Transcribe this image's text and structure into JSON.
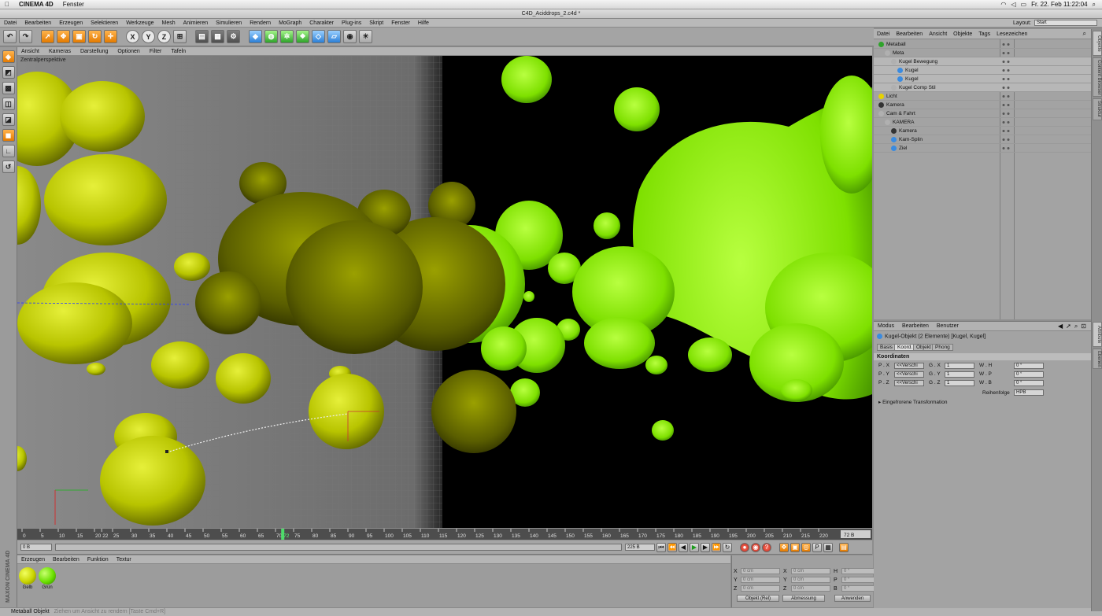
{
  "mac_menu": {
    "app": "CINEMA 4D",
    "items": [
      "Fenster"
    ],
    "datetime": "Fr. 22. Feb  11:22:04"
  },
  "window_title": "C4D_Aciddrops_2.c4d *",
  "app_menu": [
    "Datei",
    "Bearbeiten",
    "Erzeugen",
    "Selektieren",
    "Werkzeuge",
    "Mesh",
    "Animieren",
    "Simulieren",
    "Rendern",
    "MoGraph",
    "Charakter",
    "Plug-ins",
    "Skript",
    "Fenster",
    "Hilfe"
  ],
  "layout": {
    "label": "Layout:",
    "value": "Start"
  },
  "toolbar": {
    "x_label": "X",
    "y_label": "Y",
    "z_label": "Z"
  },
  "viewport": {
    "menu": [
      "Ansicht",
      "Kameras",
      "Darstellung",
      "Optionen",
      "Filter",
      "Tafeln"
    ],
    "label": "Zentralperspektive"
  },
  "timeline": {
    "ticks": [
      "0",
      "5",
      "10",
      "15",
      "20",
      "25",
      "30",
      "35",
      "40",
      "45",
      "50",
      "55",
      "60",
      "65",
      "70",
      "72",
      "75",
      "80",
      "85",
      "90",
      "95",
      "100",
      "105",
      "110",
      "115",
      "120",
      "125",
      "130",
      "135",
      "140",
      "145",
      "150",
      "155",
      "160",
      "165",
      "170",
      "175",
      "180",
      "185",
      "190",
      "195",
      "200",
      "205",
      "210",
      "215",
      "220",
      "22"
    ],
    "current_frame": "72",
    "right_field": "72 B",
    "start_field": "0 B",
    "end_field": "225 B"
  },
  "material_manager": {
    "menu": [
      "Erzeugen",
      "Bearbeiten",
      "Funktion",
      "Textur"
    ],
    "materials": [
      {
        "name": "Gelb",
        "color": "#c8d400"
      },
      {
        "name": "Grün",
        "color": "#6ae000"
      }
    ]
  },
  "coordinates": {
    "rows": [
      {
        "axis": "X",
        "pos": "0 cm",
        "size_axis": "X",
        "size": "0 cm",
        "rot_axis": "H",
        "rot": "0 °"
      },
      {
        "axis": "Y",
        "pos": "0 cm",
        "size_axis": "Y",
        "size": "0 cm",
        "rot_axis": "P",
        "rot": "0 °"
      },
      {
        "axis": "Z",
        "pos": "0 cm",
        "size_axis": "Z",
        "size": "0 cm",
        "rot_axis": "B",
        "rot": "0 °"
      }
    ],
    "mode": "Objekt (Rel)",
    "measure": "Abmessung",
    "apply": "Anwenden"
  },
  "object_manager": {
    "menu": [
      "Datei",
      "Bearbeiten",
      "Ansicht",
      "Objekte",
      "Tags",
      "Lesezeichen"
    ],
    "objects": [
      {
        "name": "Metaball",
        "indent": 0,
        "color": "#2fa32b"
      },
      {
        "name": "Meta",
        "indent": 1,
        "color": "#b0b0b0"
      },
      {
        "name": "Kugel Bewegung",
        "indent": 2,
        "color": "#b0b0b0"
      },
      {
        "name": "Kugel",
        "indent": 3,
        "color": "#3a8be0"
      },
      {
        "name": "Kugel",
        "indent": 3,
        "color": "#3a8be0"
      },
      {
        "name": "Kugel Comp Stil",
        "indent": 2,
        "color": "#b0b0b0"
      },
      {
        "name": "Licht",
        "indent": 0,
        "color": "#e6d200"
      },
      {
        "name": "Kamera",
        "indent": 0,
        "color": "#333333"
      },
      {
        "name": "Cam & Fahrt",
        "indent": 0,
        "color": "#b0b0b0"
      },
      {
        "name": "KAMERA",
        "indent": 1,
        "color": "#b0b0b0"
      },
      {
        "name": "Kamera",
        "indent": 2,
        "color": "#333333"
      },
      {
        "name": "Kam-Splin",
        "indent": 2,
        "color": "#3a8be0"
      },
      {
        "name": "Ziel",
        "indent": 2,
        "color": "#3a8be0"
      }
    ]
  },
  "attribute_manager": {
    "menu": [
      "Modus",
      "Bearbeiten",
      "Benutzer"
    ],
    "title": "Kugel-Objekt (2 Elemente) [Kugel, Kugel]",
    "tabs": [
      "Basis",
      "Koord.",
      "Objekt",
      "Phong"
    ],
    "active_tab": "Koord.",
    "section": "Koordinaten",
    "rows": [
      {
        "p": "P . X",
        "pv": "<<Verschi",
        "g": "G . X",
        "gv": "1",
        "w": "W . H",
        "wv": "0 °"
      },
      {
        "p": "P . Y",
        "pv": "<<Verschi",
        "g": "G . Y",
        "gv": "1",
        "w": "W . P",
        "wv": "0 °"
      },
      {
        "p": "P . Z",
        "pv": "<<Verschi",
        "g": "G . Z",
        "gv": "1",
        "w": "W . B",
        "wv": "0 °"
      }
    ],
    "order_label": "Reihenfolge",
    "order_value": "HPB",
    "frozen": "Eingefrorene Transformation"
  },
  "right_tabs": {
    "top": [
      "Objekte",
      "Content Browser",
      "Struktur"
    ],
    "bottom": [
      "Attribute",
      "Ebenen"
    ]
  },
  "status": {
    "text": "Metaball Objekt",
    "hint": "Ziehen um Ansicht zu rendern [Taste Cmd+R]"
  }
}
